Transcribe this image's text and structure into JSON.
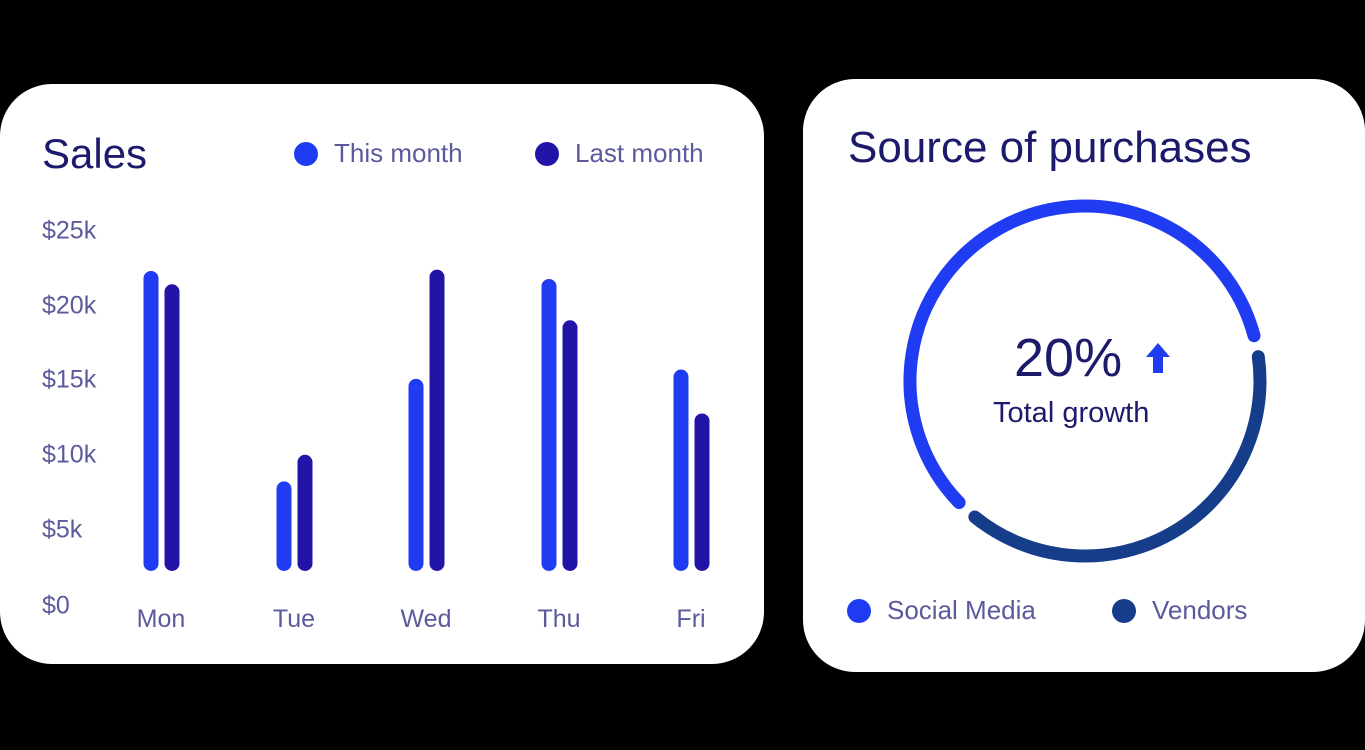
{
  "colors": {
    "this_month": "#1f3cf2",
    "last_month": "#2314a8",
    "social_media": "#1f3cf2",
    "vendors": "#163d8a"
  },
  "sales_card": {
    "title": "Sales",
    "legend": [
      "This month",
      "Last month"
    ]
  },
  "source_card": {
    "title": "Source of purchases",
    "growth_value": "20%",
    "growth_label": "Total growth",
    "growth_icon": "arrow-up-icon",
    "legend": [
      "Social Media",
      "Vendors"
    ]
  },
  "chart_data": [
    {
      "type": "bar",
      "title": "Sales",
      "categories": [
        "Mon",
        "Tue",
        "Wed",
        "Thu",
        "Fri"
      ],
      "series": [
        {
          "name": "This month",
          "values": [
            22000,
            6200,
            13900,
            21400,
            14600
          ]
        },
        {
          "name": "Last month",
          "values": [
            21000,
            8200,
            22100,
            18300,
            11300
          ]
        }
      ],
      "ylim": [
        0,
        25000
      ],
      "yticks": [
        0,
        5000,
        10000,
        15000,
        20000,
        25000
      ],
      "ytick_labels": [
        "$0",
        "$5k",
        "$10k",
        "$15k",
        "$20k",
        "$25k"
      ],
      "legend_position": "top-right",
      "grid": false
    },
    {
      "type": "pie",
      "title": "Source of purchases",
      "categories": [
        "Social Media",
        "Vendors"
      ],
      "values": [
        60,
        40
      ],
      "legend_position": "bottom"
    }
  ]
}
